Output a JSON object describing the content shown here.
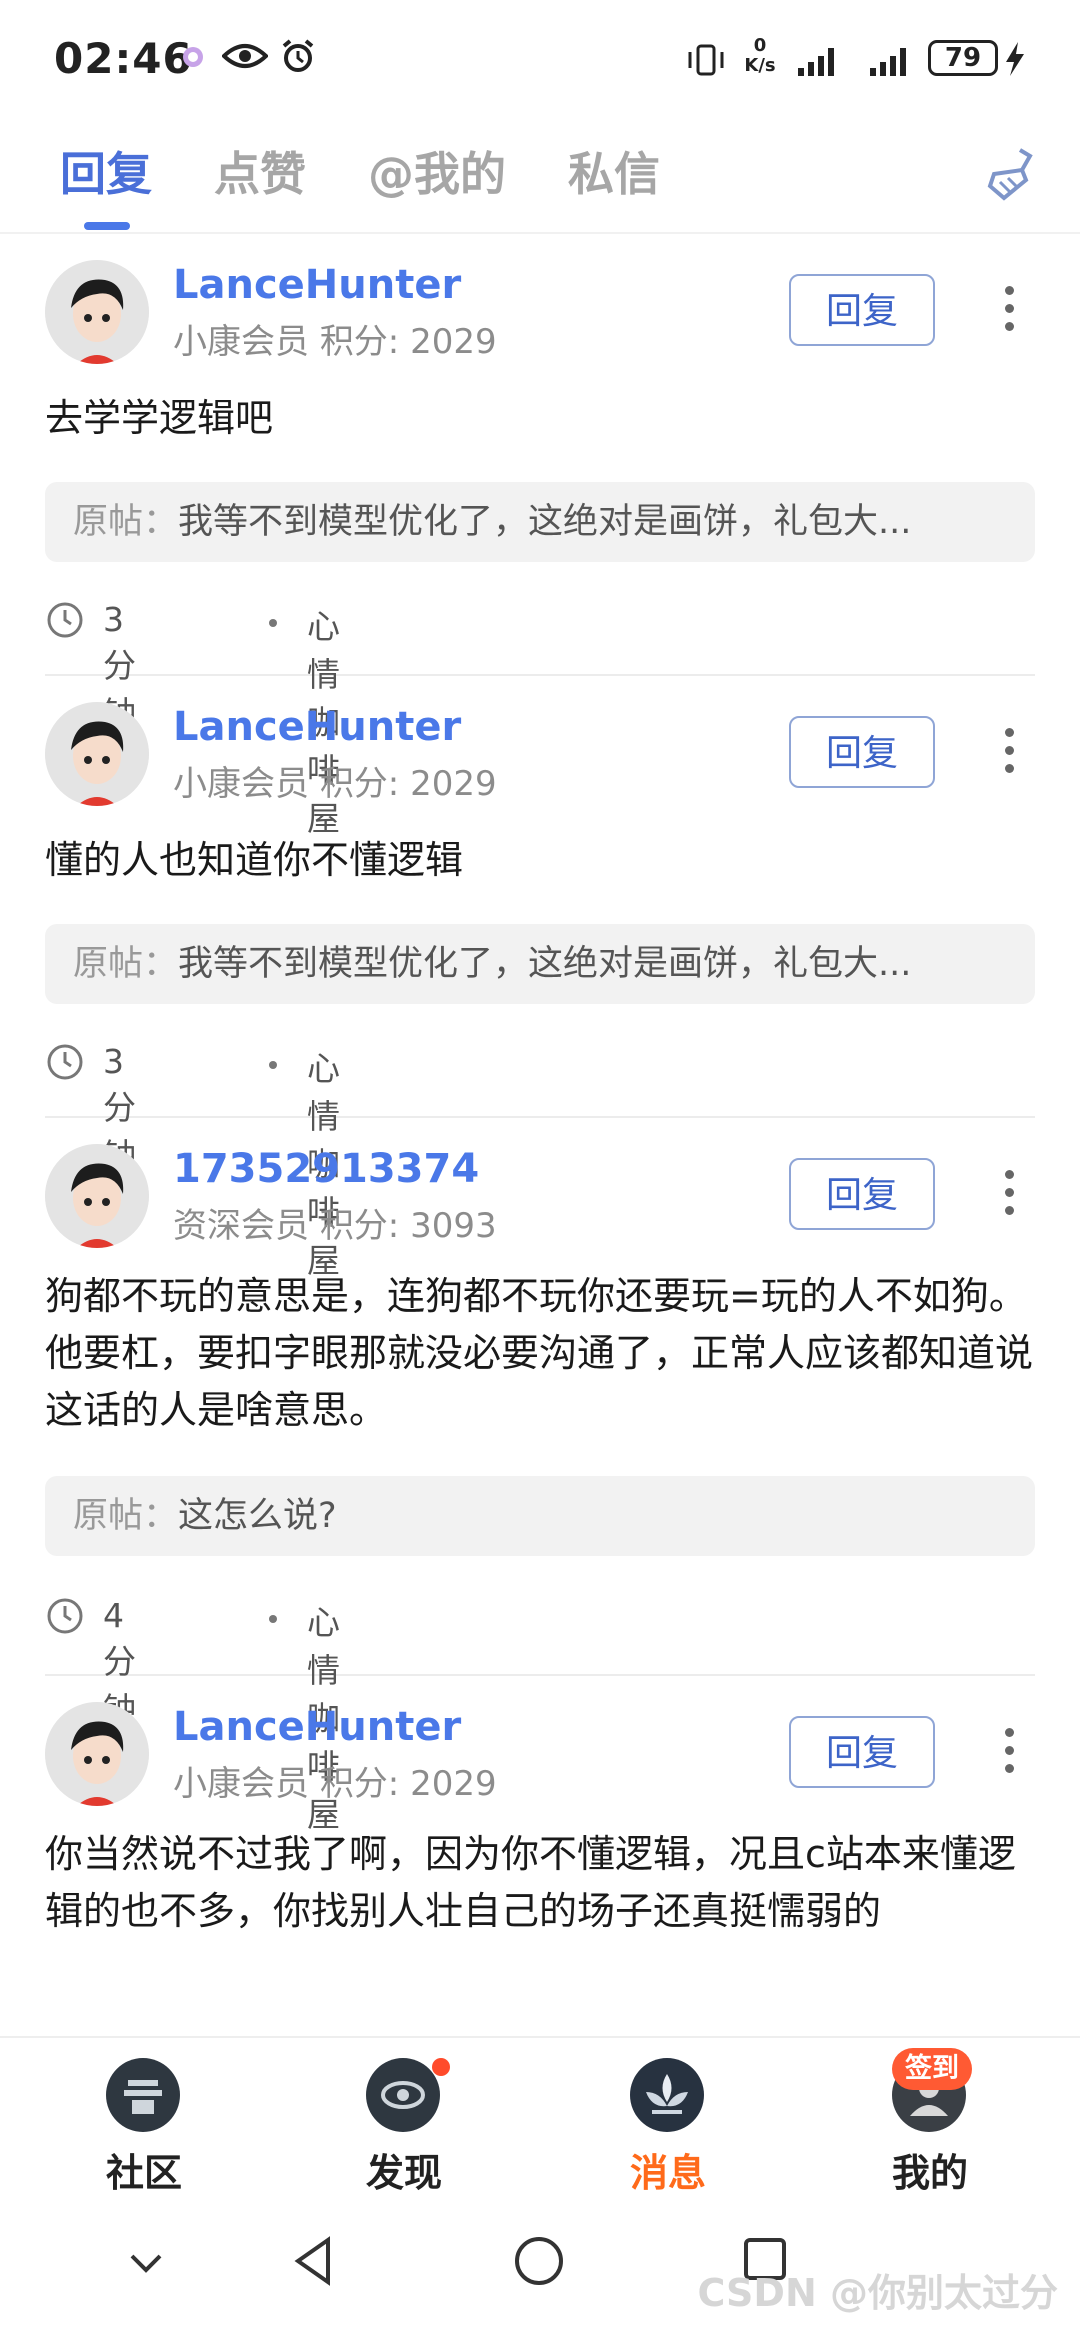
{
  "status_bar": {
    "time": "02:46",
    "net_speed_value": "0",
    "net_speed_unit": "K/s",
    "battery": "79",
    "icons": [
      "app-notification-icon",
      "eye-icon",
      "alarm-icon",
      "vibrate-icon",
      "net-speed-icon",
      "signal-icon",
      "signal-icon",
      "battery-icon",
      "charging-icon"
    ]
  },
  "tabs": [
    {
      "label": "回复",
      "active": true
    },
    {
      "label": "点赞",
      "active": false
    },
    {
      "label": "@我的",
      "active": false
    },
    {
      "label": "私信",
      "active": false
    }
  ],
  "reply_button_label": "回复",
  "quote_prefix": "原帖：",
  "posts": [
    {
      "username": "LanceHunter",
      "level": "小康会员",
      "points_label": "积分: 2029",
      "content": "去学学逻辑吧",
      "quote": "我等不到模型优化了，这绝对是画饼，礼包大...",
      "time": "3分钟前",
      "forum": "心情咖啡屋"
    },
    {
      "username": "LanceHunter",
      "level": "小康会员",
      "points_label": "积分: 2029",
      "content": "懂的人也知道你不懂逻辑",
      "quote": "我等不到模型优化了，这绝对是画饼，礼包大...",
      "time": "3分钟前",
      "forum": "心情咖啡屋"
    },
    {
      "username": "17352913374",
      "level": "资深会员",
      "points_label": "积分: 3093",
      "content": "狗都不玩的意思是，连狗都不玩你还要玩=玩的人不如狗。他要杠，要扣字眼那就没必要沟通了，正常人应该都知道说这话的人是啥意思。",
      "quote": "这怎么说?",
      "time": "4分钟前",
      "forum": "心情咖啡屋"
    },
    {
      "username": "LanceHunter",
      "level": "小康会员",
      "points_label": "积分: 2029",
      "content": "你当然说不过我了啊，因为你不懂逻辑，况且c站本来懂逻辑的也不多，你找别人壮自己的场子还真挺懦弱的"
    }
  ],
  "bottom_nav": [
    {
      "label": "社区",
      "icon": "community-icon",
      "active": false
    },
    {
      "label": "发现",
      "icon": "discover-icon",
      "active": false,
      "badge_dot": true
    },
    {
      "label": "消息",
      "icon": "message-icon",
      "active": true
    },
    {
      "label": "我的",
      "icon": "profile-icon",
      "active": false,
      "badge": "签到"
    }
  ],
  "system_nav": [
    "down-chevron-icon",
    "back-icon",
    "home-icon",
    "recents-icon"
  ],
  "watermark": "CSDN @你别太过分",
  "colors": {
    "accent": "#4a78e8",
    "active_nav": "#ff6a1a",
    "badge": "#ff5a33"
  }
}
